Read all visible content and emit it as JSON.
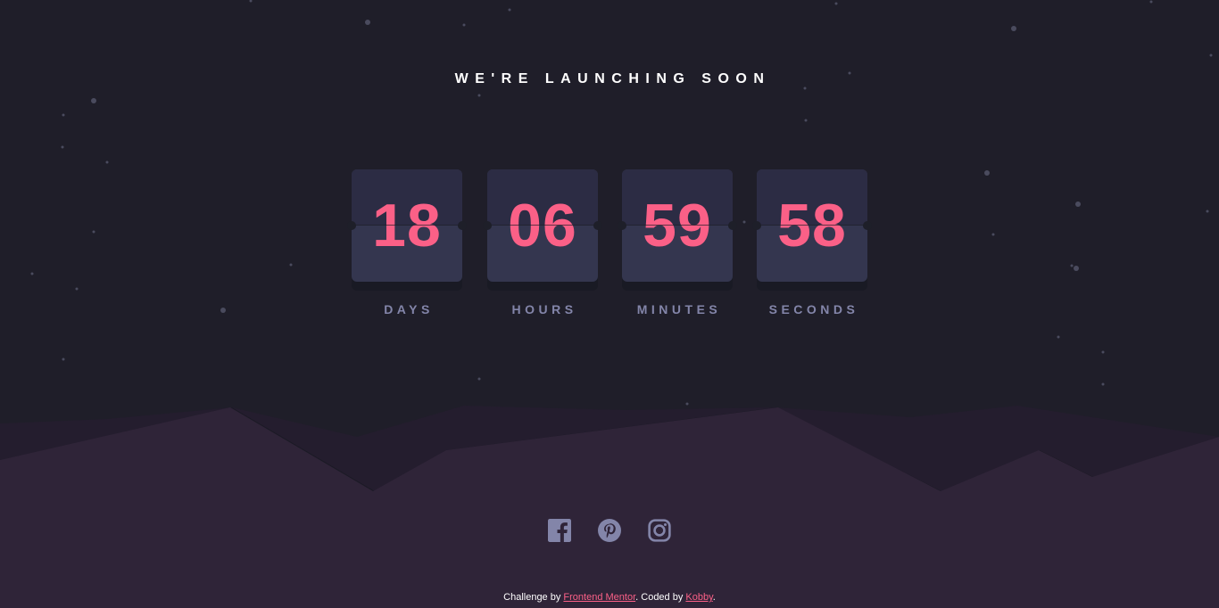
{
  "header": {
    "title": "WE'RE LAUNCHING SOON"
  },
  "countdown": [
    {
      "value": "18",
      "label": "DAYS"
    },
    {
      "value": "06",
      "label": "HOURS"
    },
    {
      "value": "59",
      "label": "MINUTES"
    },
    {
      "value": "58",
      "label": "SECONDS"
    }
  ],
  "social": {
    "icons": [
      "facebook-icon",
      "pinterest-icon",
      "instagram-icon"
    ]
  },
  "footer": {
    "prefix": "Challenge by ",
    "challenge_link": "Frontend Mentor",
    "middle": ". Coded by ",
    "author_link": "Kobby",
    "suffix": "."
  },
  "colors": {
    "background": "#1f1e29",
    "card": "#34364f",
    "accent": "#fb6087",
    "label": "#8385a9",
    "hills": "#2f2438"
  }
}
